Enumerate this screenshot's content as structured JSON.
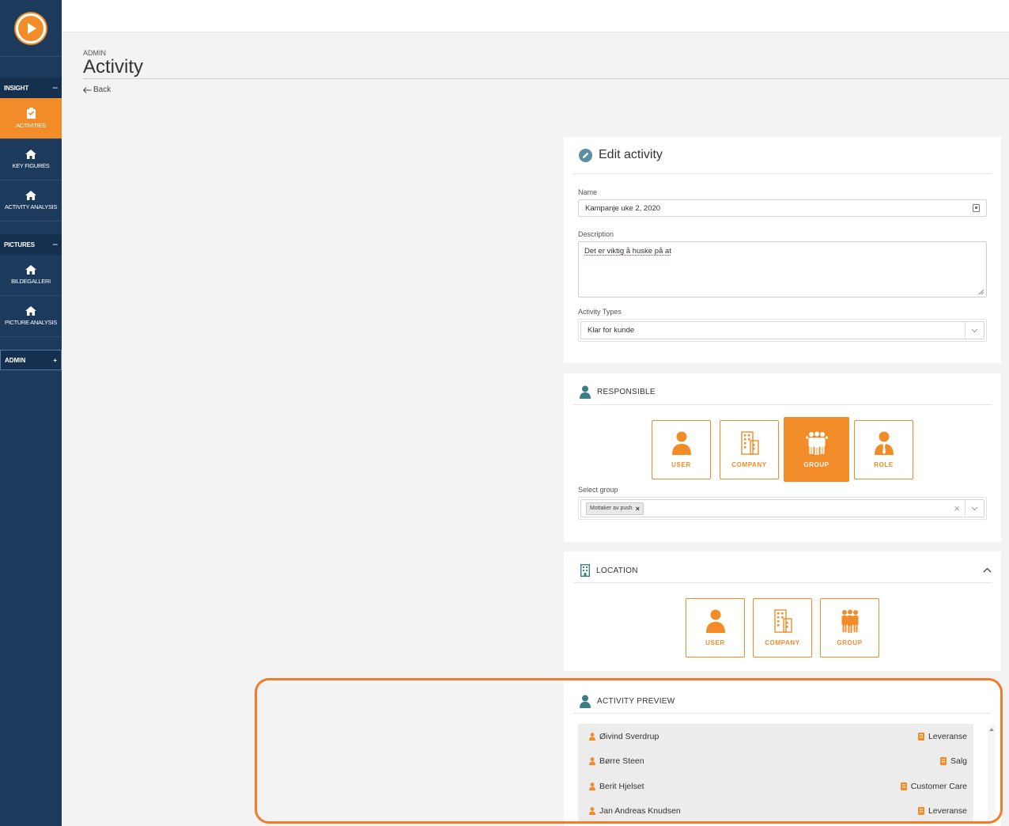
{
  "sidebar": {
    "sections": [
      {
        "label": "INSIGHT",
        "toggle": "−"
      },
      {
        "label": "PICTURES",
        "toggle": "−"
      },
      {
        "label": "ADMIN",
        "toggle": "+"
      }
    ],
    "items": [
      {
        "label": "ACTIVITIES",
        "icon": "clipboard-icon"
      },
      {
        "label": "KEY FIGURES",
        "icon": "home-icon"
      },
      {
        "label": "ACTIVITY ANALYSIS",
        "icon": "home-icon"
      },
      {
        "label": "BILDEGALLERI",
        "icon": "home-icon"
      },
      {
        "label": "PICTURE ANALYSIS",
        "icon": "home-icon"
      }
    ]
  },
  "header": {
    "crumb": "ADMIN",
    "title": "Activity",
    "back_label": "Back"
  },
  "edit_activity": {
    "title": "Edit activity",
    "name_label": "Name",
    "name_value": "Kampanje uke 2, 2020",
    "description_label": "Description",
    "description_value": "Det er viktig å huske på at",
    "types_label": "Activity Types",
    "types_value": "Klar for kunde"
  },
  "responsible": {
    "title": "RESPONSIBLE",
    "tiles": [
      {
        "label": "USER"
      },
      {
        "label": "COMPANY"
      },
      {
        "label": "GROUP"
      },
      {
        "label": "ROLE"
      }
    ],
    "select_label": "Select group",
    "selected_tag": "Mottaker av push",
    "tag_remove": "×",
    "clear_glyph": "×"
  },
  "location": {
    "title": "LOCATION",
    "tiles": [
      {
        "label": "USER"
      },
      {
        "label": "COMPANY"
      },
      {
        "label": "GROUP"
      }
    ]
  },
  "preview": {
    "title": "ACTIVITY PREVIEW",
    "rows": [
      {
        "name": "Øivind Sverdrup",
        "group": "Leveranse"
      },
      {
        "name": "Børre Steen",
        "group": "Salg"
      },
      {
        "name": "Berit Hjelset",
        "group": "Customer Care"
      },
      {
        "name": "Jan Andreas Knudsen",
        "group": "Leveranse"
      }
    ]
  },
  "colors": {
    "accent": "#f28c28",
    "sidebar": "#1b3a5c",
    "teal": "#3a7f84",
    "highlight": "#f07b2a"
  }
}
